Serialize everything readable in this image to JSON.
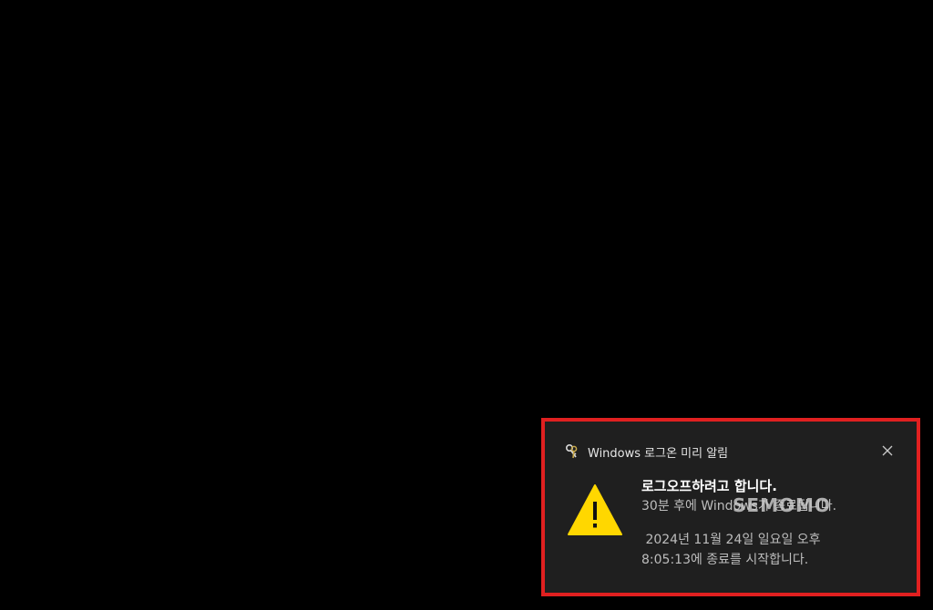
{
  "notification": {
    "app_name": "Windows 로그온 미리 알림",
    "title": "로그오프하려고 합니다.",
    "line1": "30분 후에 Windows가 종료됩니다.",
    "line2": " 2024년 11월 24일 일요일 오후",
    "line3": "8:05:13에 종료를 시작합니다.",
    "close_icon": "close-icon",
    "warning_icon": "warning-icon"
  },
  "watermark": "SEMOMO",
  "colors": {
    "background": "#000000",
    "toast_bg": "#1f1f1f",
    "highlight_border": "#e02020",
    "warning_yellow": "#ffd700"
  }
}
